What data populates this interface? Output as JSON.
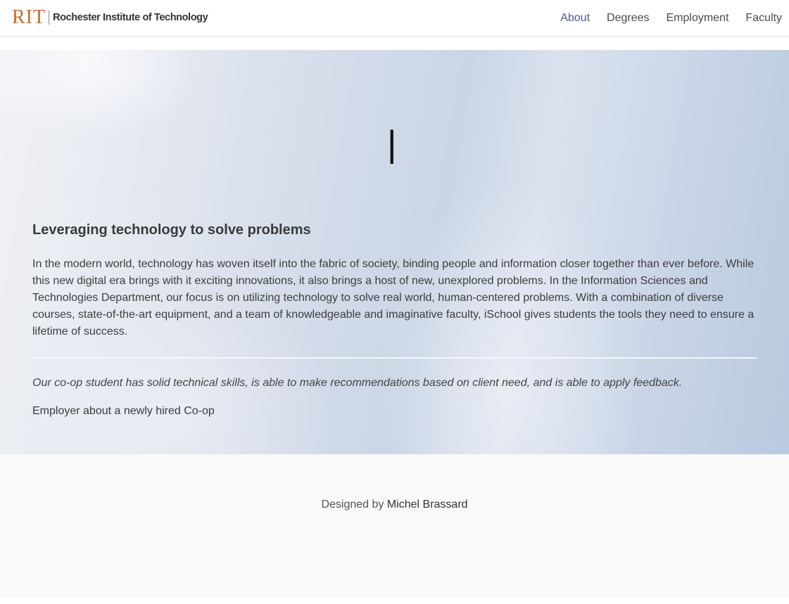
{
  "header": {
    "logo": {
      "mark": "RIT",
      "name": "Rochester Institute of Technology"
    },
    "nav": [
      {
        "label": "About",
        "active": true
      },
      {
        "label": "Degrees",
        "active": false
      },
      {
        "label": "Employment",
        "active": false
      },
      {
        "label": "Faculty",
        "active": false
      }
    ],
    "active_color": "#4a55a2"
  },
  "hero": {
    "typed_text": "|",
    "title": "Leveraging technology to solve problems",
    "body": "In the modern world, technology has woven itself into the fabric of society, binding people and information closer together than ever before. While this new digital era brings with it exciting innovations, it also brings a host of new, unexplored problems. In the Information Sciences and Technologies Department, our focus is on utilizing technology to solve real world, human-centered problems. With a combination of diverse courses, state-of-the-art equipment, and a team of knowledgeable and imaginative faculty, iSchool gives students the tools they need to ensure a lifetime of success.",
    "quote": "Our co-op student has solid technical skills, is able to make recommendations based on client need, and is able to apply feedback.",
    "quote_source": "Employer about a newly hired Co-op"
  },
  "footer": {
    "prefix": "Designed by",
    "author": "Michel Brassard"
  },
  "colors": {
    "brand_orange": "#c96a2a",
    "footer_bg": "#f9f9f9"
  }
}
